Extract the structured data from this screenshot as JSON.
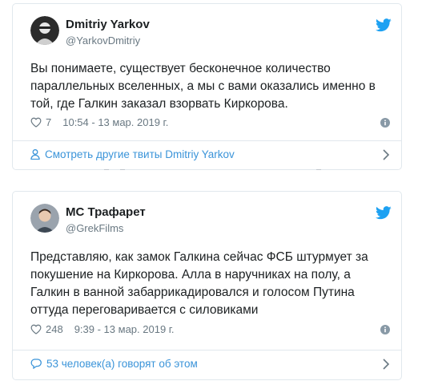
{
  "tweets": [
    {
      "author_name": "Dmitriy Yarkov",
      "author_handle": "@YarkovDmitriy",
      "text": "Вы понимаете, существует бесконечное количество параллельных вселенных, а мы с вами оказались именно в той, где Галкин заказал взорвать Киркорова.",
      "likes": "7",
      "timestamp": "10:54 - 13 мар. 2019 г.",
      "footer_link": "Смотреть другие твиты Dmitriy Yarkov",
      "footer_icon": "person-icon"
    },
    {
      "author_name": "МС Трафарет",
      "author_handle": "@GrekFilms",
      "text": "Представляю, как замок Галкина сейчас ФСБ штурмует за покушение на Киркорова. Алла в наручниках на полу, а Галкин в ванной забаррикадировался и голосом Путина оттуда переговаривается с силовиками",
      "likes": "248",
      "timestamp": "9:39 - 13 мар. 2019 г.",
      "footer_link": "53 человек(а) говорят об этом",
      "footer_icon": "comment-bubble-icon"
    }
  ],
  "colors": {
    "twitter_blue": "#1da1f2",
    "link": "#3b94d9",
    "meta": "#697882",
    "border": "#e1e8ed"
  }
}
